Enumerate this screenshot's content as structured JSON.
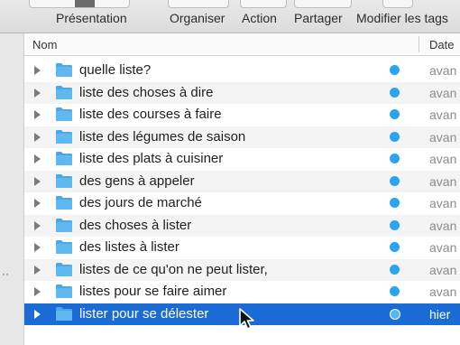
{
  "toolbar": {
    "items": [
      {
        "label": "Présentation",
        "name": "toolbar-presentation-button"
      },
      {
        "label": "Organiser",
        "name": "toolbar-organiser-button"
      },
      {
        "label": "Action",
        "name": "toolbar-action-button"
      },
      {
        "label": "Partager",
        "name": "toolbar-partager-button"
      },
      {
        "label": "Modifier les tags",
        "name": "toolbar-modifier-tags-button"
      }
    ]
  },
  "columns": {
    "name": "Nom",
    "date": "Date"
  },
  "gutter": {
    "dots": "··"
  },
  "rows": [
    {
      "name": "quelle liste?",
      "date": "avan",
      "selected": false
    },
    {
      "name": "liste des choses à dire",
      "date": "avan",
      "selected": false
    },
    {
      "name": "liste des courses à faire",
      "date": "avan",
      "selected": false
    },
    {
      "name": "liste des légumes de saison",
      "date": "avan",
      "selected": false
    },
    {
      "name": "liste des plats à cuisiner",
      "date": "avan",
      "selected": false
    },
    {
      "name": "des gens à appeler",
      "date": "avan",
      "selected": false
    },
    {
      "name": "des jours de marché",
      "date": "avan",
      "selected": false
    },
    {
      "name": "des choses à lister",
      "date": "avan",
      "selected": false
    },
    {
      "name": "des listes à lister",
      "date": "avan",
      "selected": false
    },
    {
      "name": "listes de ce qu'on ne peut lister,",
      "date": "avan",
      "selected": false
    },
    {
      "name": "listes pour se faire aimer",
      "date": "avan",
      "selected": false
    },
    {
      "name": "lister pour se délester",
      "date": "hier",
      "selected": true
    }
  ],
  "colors": {
    "selection": "#1a6bd6",
    "folder": "#5fb8ef",
    "status_dot": "#2aa4ee"
  },
  "icons": {
    "folder": "folder-icon",
    "disclosure": "disclosure-triangle-icon",
    "status": "status-dot-icon",
    "cursor": "mouse-pointer-icon"
  }
}
